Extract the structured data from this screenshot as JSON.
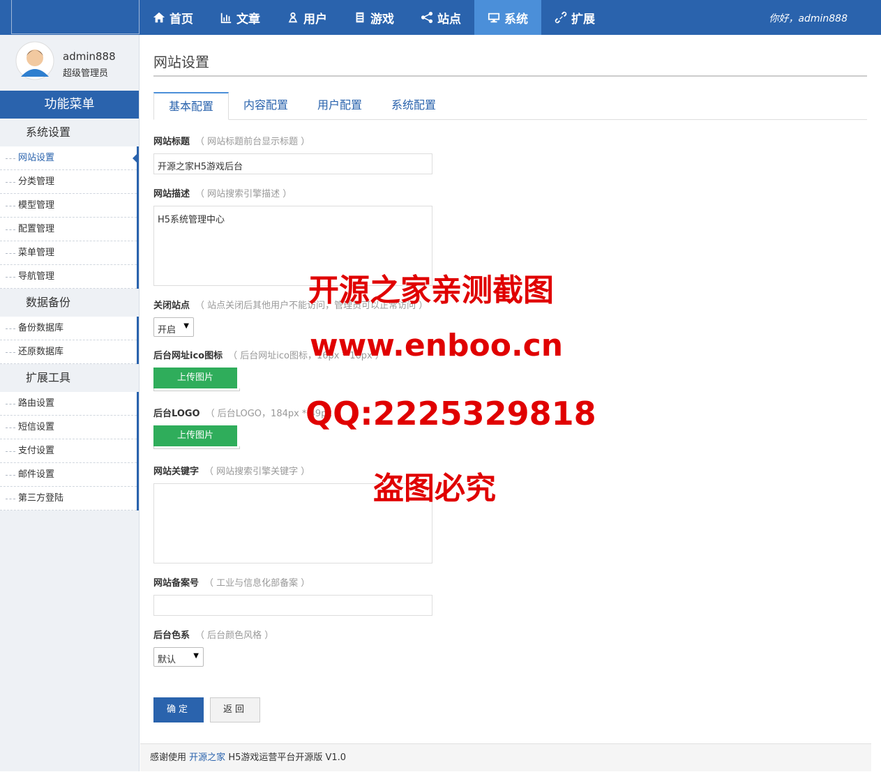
{
  "nav": {
    "items": [
      {
        "label": "首页",
        "icon": "home-icon"
      },
      {
        "label": "文章",
        "icon": "bar-chart-icon"
      },
      {
        "label": "用户",
        "icon": "user-icon"
      },
      {
        "label": "游戏",
        "icon": "document-icon"
      },
      {
        "label": "站点",
        "icon": "share-icon"
      },
      {
        "label": "系统",
        "icon": "monitor-icon",
        "active": true
      },
      {
        "label": "扩展",
        "icon": "link-icon"
      }
    ],
    "greeting": "你好，admin888"
  },
  "profile": {
    "username": "admin888",
    "role": "超级管理员"
  },
  "sidebar": {
    "menu_title": "功能菜单",
    "groups": [
      {
        "title": "系统设置",
        "items": [
          "网站设置",
          "分类管理",
          "模型管理",
          "配置管理",
          "菜单管理",
          "导航管理"
        ]
      },
      {
        "title": "数据备份",
        "items": [
          "备份数据库",
          "还原数据库"
        ]
      },
      {
        "title": "扩展工具",
        "items": [
          "路由设置",
          "短信设置",
          "支付设置",
          "邮件设置",
          "第三方登陆"
        ]
      }
    ]
  },
  "page": {
    "title": "网站设置",
    "tabs": [
      "基本配置",
      "内容配置",
      "用户配置",
      "系统配置"
    ]
  },
  "form": {
    "site_title": {
      "label": "网站标题",
      "hint": "（ 网站标题前台显示标题 ）",
      "value": "开源之家H5游戏后台"
    },
    "site_desc": {
      "label": "网站描述",
      "hint": "（ 网站搜索引擎描述 ）",
      "value": "H5系统管理中心"
    },
    "close_site": {
      "label": "关闭站点",
      "hint": "（ 站点关闭后其他用户不能访问，管理员可以正常访问 ）",
      "value": "开启"
    },
    "ico": {
      "label": "后台网址ico图标",
      "hint": "（ 后台网址ico图标，16px * 16px ）",
      "button": "上传图片"
    },
    "logo": {
      "label": "后台LOGO",
      "hint": "（ 后台LOGO，184px * 49px ）",
      "button": "上传图片"
    },
    "keywords": {
      "label": "网站关键字",
      "hint": "（ 网站搜索引擎关键字 ）",
      "value": ""
    },
    "icp": {
      "label": "网站备案号",
      "hint": "（ 工业与信息化部备案 ）",
      "value": ""
    },
    "theme": {
      "label": "后台色系",
      "hint": "（ 后台颜色风格 ）",
      "value": "默认"
    },
    "ok_label": "确定",
    "back_label": "返回"
  },
  "footer": {
    "prefix": "感谢使用",
    "link": "开源之家",
    "suffix": "H5游戏运营平台开源版 V1.0"
  },
  "watermark": {
    "line1": "开源之家亲测截图",
    "line2": "www.enboo.cn",
    "line3": "QQ:2225329818",
    "line4": "盗图必究"
  },
  "colors": {
    "primary": "#2a63ad",
    "nav_active": "#4b8fd9",
    "upload": "#2fad5b",
    "watermark": "#e00000"
  }
}
